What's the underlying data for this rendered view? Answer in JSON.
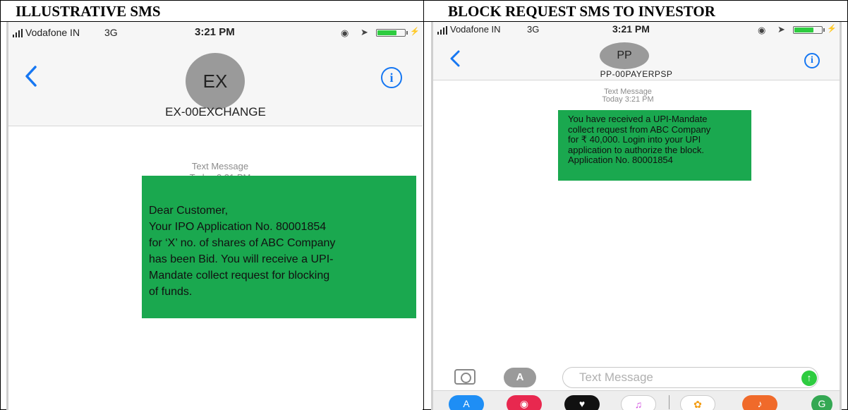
{
  "headers": {
    "left": "ILLUSTRATIVE SMS",
    "right": "BLOCK REQUEST SMS TO INVESTOR"
  },
  "left_phone": {
    "status_bar": {
      "carrier": "Vodafone IN",
      "network": "3G",
      "time": "3:21 PM"
    },
    "contact_avatar": "EX",
    "contact_name": "EX-00EXCHANGE",
    "message_meta": {
      "label": "Text Message",
      "time": "Today 3:21 PM"
    },
    "message_lines": [
      "Dear Customer,",
      "Your IPO Application No. 80001854",
      "for ‘X’ no. of shares of ABC Company",
      "has been Bid. You will receive a UPI-",
      "Mandate collect request for blocking",
      "of funds."
    ]
  },
  "right_phone": {
    "status_bar": {
      "carrier": "Vodafone IN",
      "network": "3G",
      "time": "3:21 PM"
    },
    "contact_avatar": "PP",
    "contact_name": "PP-00PAYERPSP",
    "message_meta": {
      "label": "Text Message",
      "time": "Today 3:21 PM"
    },
    "message_lines": [
      "You have received a UPI-Mandate",
      "collect request from ABC Company",
      "for ₹ 40,000. Login into your UPI",
      "application to authorize the block.",
      "Application No. 80001854"
    ],
    "composer": {
      "placeholder": "Text Message"
    }
  },
  "colors": {
    "bubble": "#1aa84f",
    "ios_blue": "#1677f2",
    "send": "#2ecc40"
  },
  "icons": [
    "signal-icon",
    "back-chevron-icon",
    "info-icon",
    "camera-icon",
    "app-store-icon",
    "send-icon",
    "music-icon",
    "photos-icon",
    "maps-icon"
  ]
}
